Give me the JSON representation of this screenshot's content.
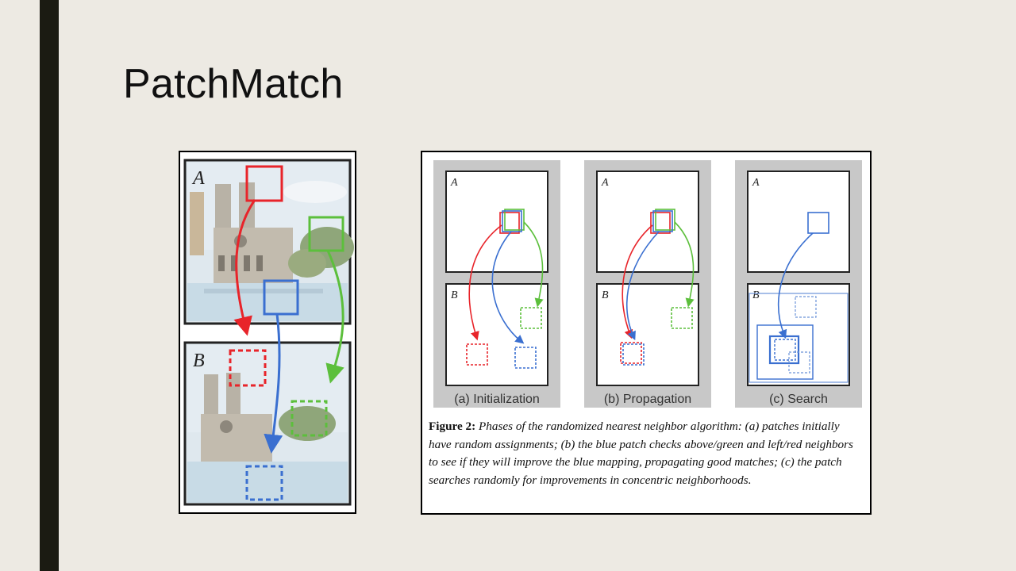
{
  "slide": {
    "title": "PatchMatch"
  },
  "left_figure": {
    "label_a": "A",
    "label_b": "B"
  },
  "right_figure": {
    "panels": [
      {
        "label_a": "A",
        "label_b": "B",
        "caption": "(a) Initialization"
      },
      {
        "label_a": "A",
        "label_b": "B",
        "caption": "(b) Propagation"
      },
      {
        "label_a": "A",
        "label_b": "B",
        "caption": "(c) Search"
      }
    ],
    "caption_label": "Figure 2:",
    "caption_text": "Phases of the randomized nearest neighbor algorithm: (a) patches initially have random assignments; (b) the blue patch checks above/green and left/red neighbors to see if they will improve the blue mapping, propagating good matches; (c) the patch searches randomly for improvements in concentric neighborhoods."
  },
  "colors": {
    "red": "#e8242a",
    "green": "#5cbf3c",
    "blue": "#3a6fd0",
    "accent_bar": "#1b1b12",
    "background": "#edeae3"
  }
}
